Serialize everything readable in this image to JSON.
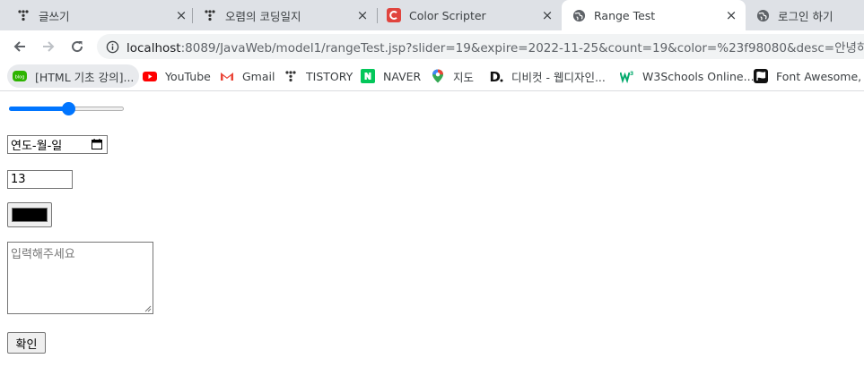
{
  "browser": {
    "tabs": [
      {
        "title": "글쓰기",
        "icon": "tistory-dots-icon",
        "active": false
      },
      {
        "title": "오렴의 코딩일지",
        "icon": "tistory-dots-icon",
        "active": false
      },
      {
        "title": "Color Scripter",
        "icon": "color-scripter-icon",
        "active": false
      },
      {
        "title": "Range Test",
        "icon": "globe-icon",
        "active": true
      },
      {
        "title": "로그인 하기",
        "icon": "globe-icon",
        "active": false
      }
    ],
    "close_glyph": "×",
    "url_host": "localhost",
    "url_rest": ":8089/JavaWeb/model1/rangeTest.jsp?slider=19&expire=2022-11-25&count=19&color=%23f98080&desc=안녕하세요",
    "bookmarks": [
      {
        "label": "[HTML 기초 강의]...",
        "icon": "blog-icon"
      },
      {
        "label": "YouTube",
        "icon": "youtube-icon"
      },
      {
        "label": "Gmail",
        "icon": "gmail-icon"
      },
      {
        "label": "TISTORY",
        "icon": "tistory-dots-icon"
      },
      {
        "label": "NAVER",
        "icon": "naver-icon"
      },
      {
        "label": "지도",
        "icon": "maps-pin-icon"
      },
      {
        "label": "디비컷 - 웹디자인...",
        "icon": "dbcut-icon"
      },
      {
        "label": "W3Schools Online...",
        "icon": "w3schools-icon"
      },
      {
        "label": "Font Awesome, th",
        "icon": "font-awesome-flag-icon"
      }
    ]
  },
  "form": {
    "slider_value": 0.52,
    "date_placeholder": "연도-월-일",
    "count_value": "13",
    "color_value": "#000000",
    "desc_placeholder": "입력해주세요",
    "submit_label": "확인"
  },
  "colors": {
    "accent": "#0075ff",
    "tab_strip": "#dee1e6",
    "omnibox": "#f1f3f4"
  }
}
